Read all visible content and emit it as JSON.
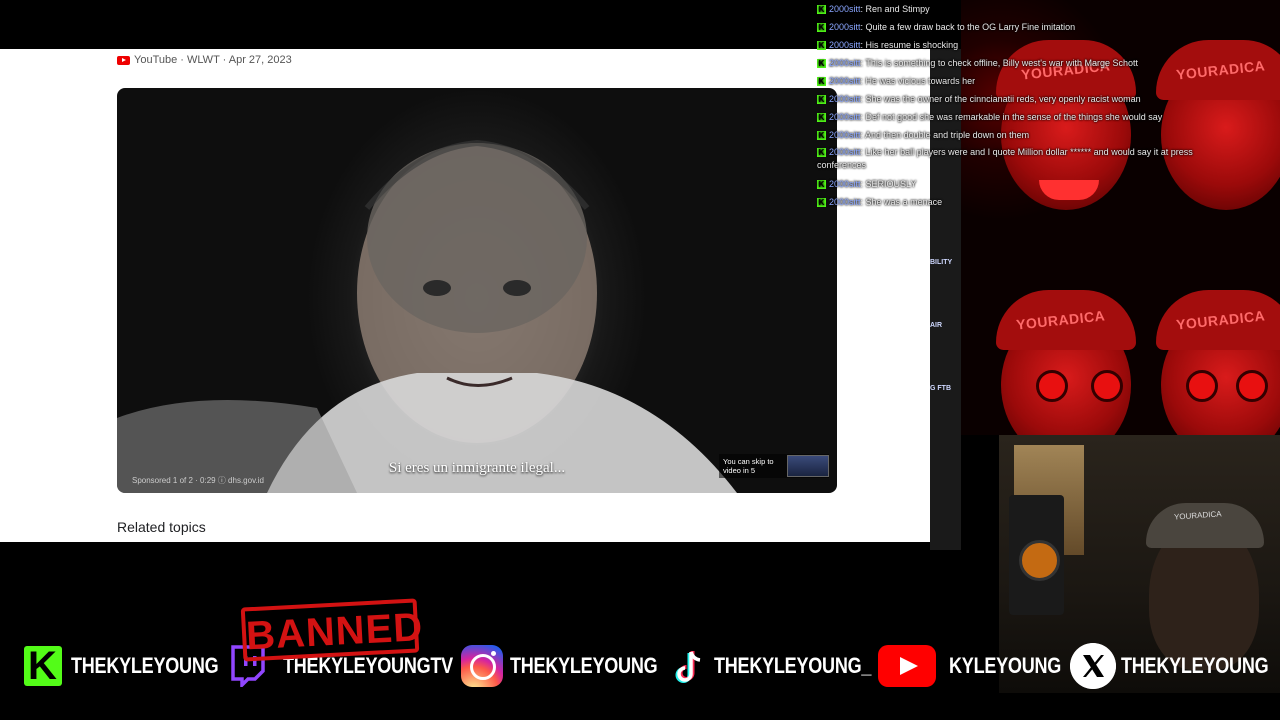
{
  "article": {
    "source_label": "YouTube · WLWT · Apr 27, 2023",
    "related_heading": "Related topics"
  },
  "video": {
    "subtitle": "Si eres un inmigrante ilegal...",
    "sponsored": "Sponsored 1 of 2 · 0:29 ⓘ dhs.gov.id",
    "skip_text": "You can skip to video in 5"
  },
  "chat": {
    "messages": [
      {
        "user": "2000sitt",
        "text": "Ren and Stimpy"
      },
      {
        "user": "2000sitt",
        "text": "Quite a few draw back to the OG Larry Fine imitation"
      },
      {
        "user": "2000sitt",
        "text": "His resume is shocking"
      },
      {
        "user": "2000sitt",
        "text": "This is something to check offline, Billy west's war with Marge Schott"
      },
      {
        "user": "2000sitt",
        "text": "He was vicious towards her"
      },
      {
        "user": "2000sitt",
        "text": "She was the owner of the cinncianatii reds, very openly racist woman"
      },
      {
        "user": "2000sitt",
        "text": "Def not good she was remarkable in the sense of the things she would say"
      },
      {
        "user": "2000sitt",
        "text": "And then double and triple down on them"
      },
      {
        "user": "2000sitt",
        "text": "Like her ball players were and I quote Million dollar ****** and would say it at press conferences"
      },
      {
        "user": "2000sitt",
        "text": "SERIOUSLY"
      },
      {
        "user": "2000sitt",
        "text": "She was a menace"
      }
    ],
    "badge_letter": "K"
  },
  "side_labels": [
    "BILITY",
    "AIR",
    "G FTB"
  ],
  "art": {
    "brand_text": "YOURADICA"
  },
  "webcam": {
    "hat_text": "YOURADICA"
  },
  "socials": {
    "kick": "THEKYLEYOUNG",
    "twitch": "THEKYLEYOUNGTV",
    "instagram": "THEKYLEYOUNG",
    "tiktok": "THEKYLEYOUNG_",
    "youtube": "KYLEYOUNG",
    "x": "THEKYLEYOUNG"
  },
  "banned_stamp": "BANNED",
  "colors": {
    "kick_green": "#53fc18",
    "chat_user": "#8aa6ff",
    "stamp_red": "#d31212"
  }
}
